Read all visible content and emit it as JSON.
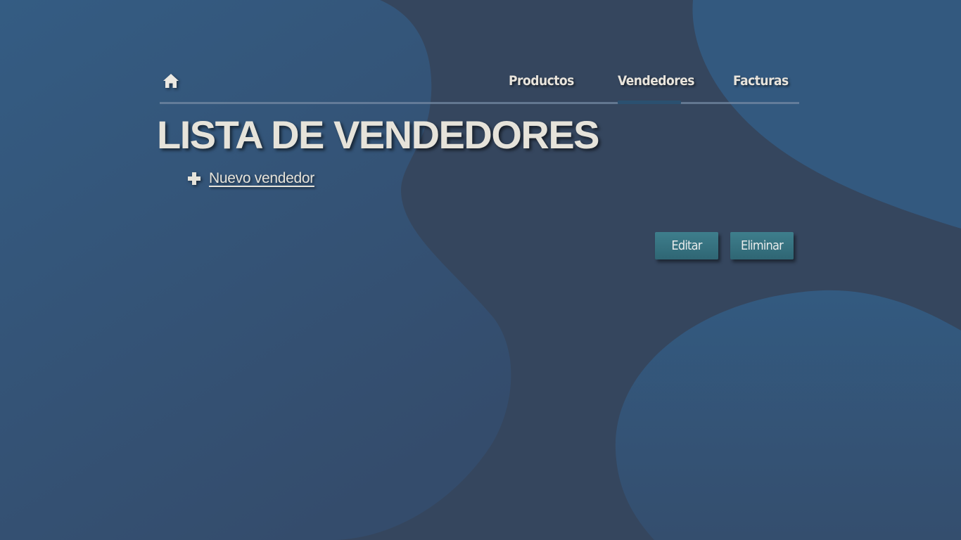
{
  "nav": {
    "home_icon": "home-icon",
    "links": [
      {
        "label": "Productos"
      },
      {
        "label": "Vendedores",
        "active": true
      },
      {
        "label": "Facturas"
      }
    ]
  },
  "page": {
    "title": "LISTA DE VENDEDORES",
    "new_icon": "plus-icon",
    "new_label": "Nuevo vendedor"
  },
  "actions": {
    "edit_label": "Editar",
    "delete_label": "Eliminar"
  },
  "colors": {
    "background": "#35465e",
    "blob": "#335a80",
    "button": "#3a7683",
    "text": "#e6e3da"
  }
}
